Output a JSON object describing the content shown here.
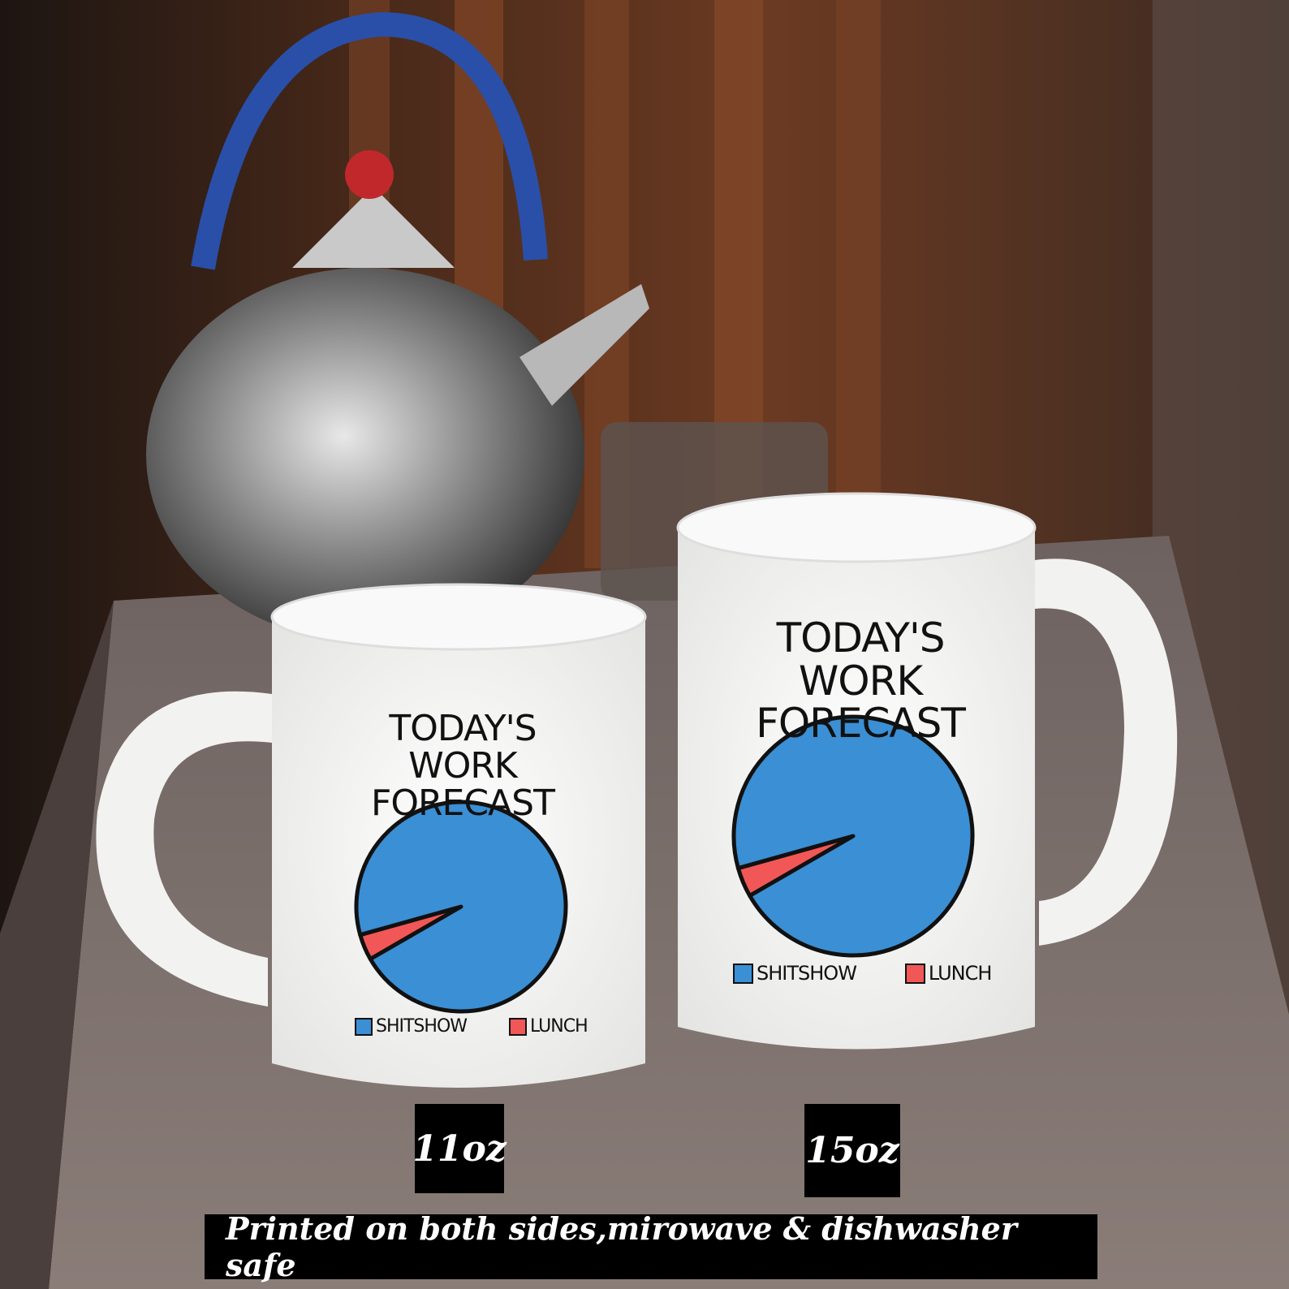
{
  "photo": {
    "subject": "two white coffee mugs on a stone counter with a kettle in the background",
    "colors": {
      "pie_blue": "#3b8fd4",
      "pie_red": "#f25757",
      "mug_white": "#f4f4f2",
      "label_bg": "#000000"
    }
  },
  "mugs": [
    {
      "title_line1": "TODAY'S",
      "title_line2": "WORK FORECAST",
      "legend_1": "SHITSHOW",
      "legend_2": "LUNCH",
      "size": "11oz"
    },
    {
      "title_line1": "TODAY'S",
      "title_line2": "WORK FORECAST",
      "legend_1": "SHITSHOW",
      "legend_2": "LUNCH",
      "size": "15oz"
    }
  ],
  "chart_data": [
    {
      "type": "pie",
      "title": "TODAY'S WORK FORECAST",
      "categories": [
        "SHITSHOW",
        "LUNCH"
      ],
      "values": [
        96,
        4
      ]
    },
    {
      "type": "pie",
      "title": "TODAY'S WORK FORECAST",
      "categories": [
        "SHITSHOW",
        "LUNCH"
      ],
      "values": [
        96,
        4
      ]
    }
  ],
  "banner": {
    "text": "Printed on both sides,mirowave & dishwasher safe"
  }
}
